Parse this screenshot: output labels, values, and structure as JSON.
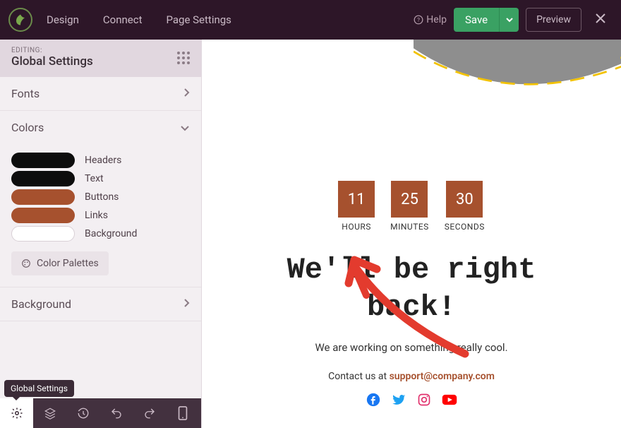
{
  "topbar": {
    "nav": {
      "design": "Design",
      "connect": "Connect",
      "page_settings": "Page Settings"
    },
    "help": "Help",
    "save": "Save",
    "preview": "Preview"
  },
  "panel": {
    "editing_label": "EDITING:",
    "title": "Global Settings",
    "sections": {
      "fonts": "Fonts",
      "colors": "Colors",
      "background": "Background"
    },
    "swatches": [
      {
        "label": "Headers",
        "color": "#0d0d0d"
      },
      {
        "label": "Text",
        "color": "#0d0d0d"
      },
      {
        "label": "Buttons",
        "color": "#a6512e"
      },
      {
        "label": "Links",
        "color": "#a6512e"
      },
      {
        "label": "Background",
        "color": "#ffffff"
      }
    ],
    "palettes_btn": "Color Palettes",
    "tooltip": "Global Settings"
  },
  "canvas": {
    "countdown": [
      {
        "value": "11",
        "label": "HOURS"
      },
      {
        "value": "25",
        "label": "MINUTES"
      },
      {
        "value": "30",
        "label": "SECONDS"
      }
    ],
    "headline": "We'll be right back!",
    "subline": "We are working on something really cool.",
    "contact_prefix": "Contact us at ",
    "contact_email": "support@company.com"
  },
  "colors": {
    "accent": "#a6512e",
    "save_green": "#3aa163"
  }
}
